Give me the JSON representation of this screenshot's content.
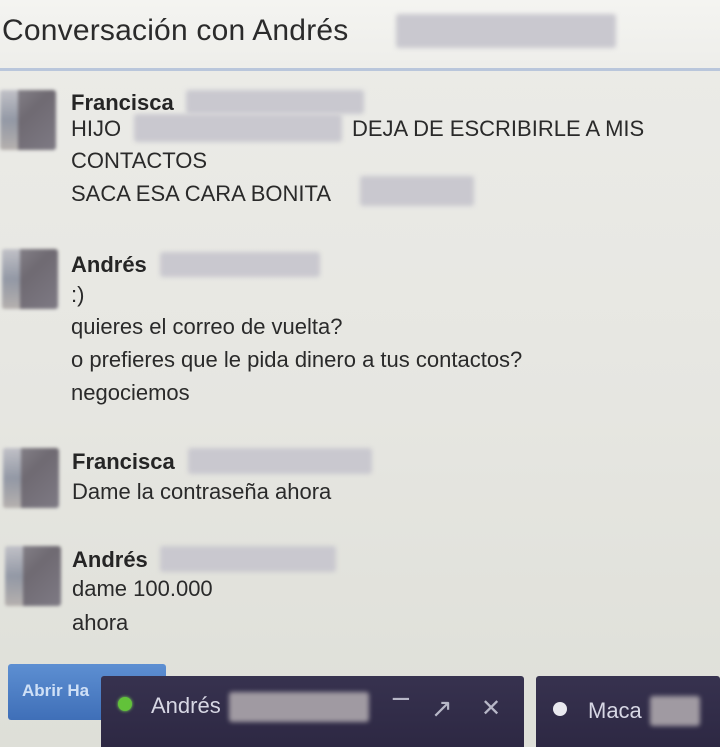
{
  "window": {
    "title": "Conversación con Andrés"
  },
  "messages": [
    {
      "sender": "Francisca",
      "lines": [
        "HIJO",
        "DEJA DE ESCRIBIRLE A MIS",
        "CONTACTOS",
        "SACA ESA CARA BONITA"
      ]
    },
    {
      "sender": "Andrés",
      "lines": [
        ":)",
        "quieres el correo de vuelta?",
        "o prefieres que le pida dinero a tus contactos?",
        "negociemos"
      ]
    },
    {
      "sender": "Francisca",
      "lines": [
        "Dame la contraseña ahora"
      ]
    },
    {
      "sender": "Andrés",
      "lines": [
        "dame 100.000",
        "ahora"
      ]
    }
  ],
  "bottom_bar": {
    "open_button_label": "Abrir Ha",
    "chat_tabs": [
      {
        "name": "Andrés",
        "status": "online",
        "status_color": "#62c23a",
        "icons": [
          "minimize-icon",
          "popout-icon",
          "close-icon"
        ],
        "icon_glyphs": {
          "minimize": "−",
          "popout": "↗",
          "close": "✕"
        }
      },
      {
        "name": "Maca",
        "status": "away",
        "status_color": "#e9e9ef"
      }
    ]
  },
  "colors": {
    "header_underline": "#b9c6db",
    "tab_background": "#37324f",
    "button_blue": "#4f80c8"
  }
}
